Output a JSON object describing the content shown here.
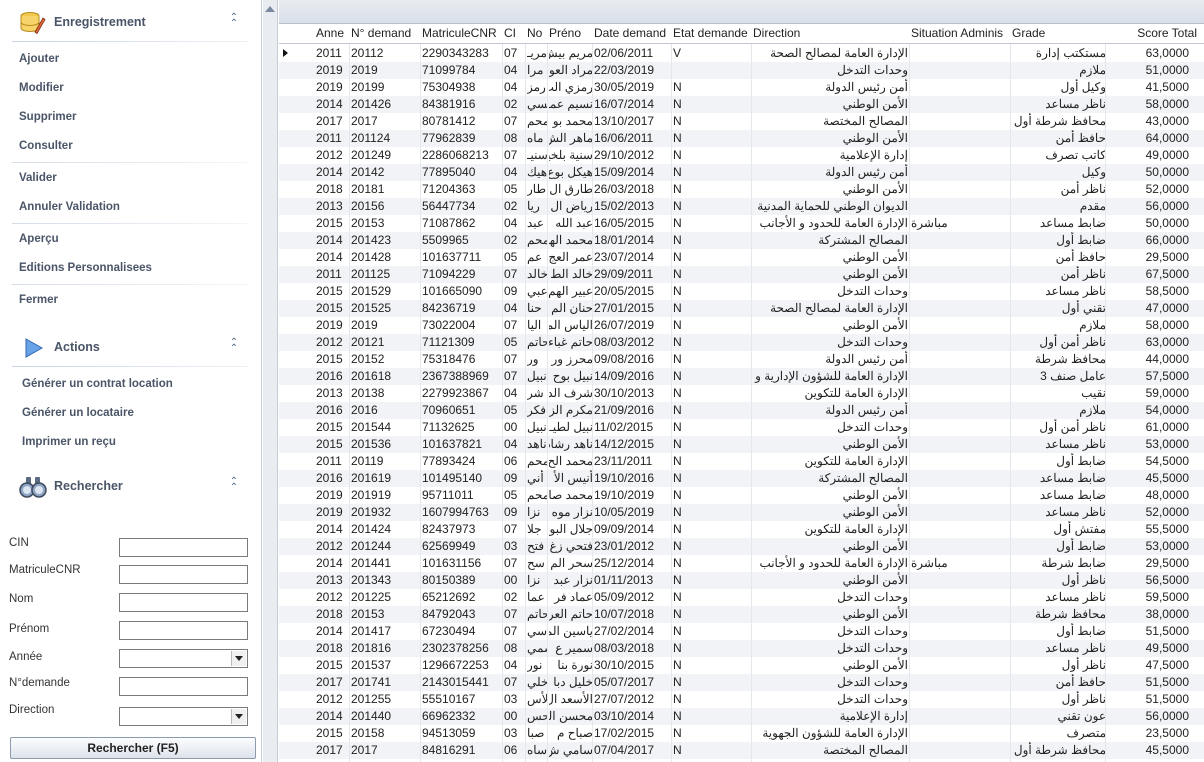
{
  "sidebar": {
    "enregistrement": {
      "title": "Enregistrement",
      "items": [
        "Ajouter",
        "Modifier",
        "Supprimer",
        "Consulter",
        "Valider",
        "Annuler Validation",
        "Aperçu",
        "Editions Personnalisees",
        "Fermer"
      ]
    },
    "actions": {
      "title": "Actions",
      "items": [
        "Générer un contrat location",
        "Générer un locataire",
        "Imprimer un reçu"
      ]
    },
    "rechercher": {
      "title": "Rechercher",
      "fields": [
        {
          "label": "CIN",
          "type": "text",
          "value": ""
        },
        {
          "label": "MatriculeCNR",
          "type": "text",
          "value": ""
        },
        {
          "label": "Nom",
          "type": "text",
          "value": ""
        },
        {
          "label": "Prénom",
          "type": "text",
          "value": ""
        },
        {
          "label": "Année",
          "type": "select",
          "value": ""
        },
        {
          "label": "N°demande",
          "type": "text",
          "value": ""
        },
        {
          "label": "Direction",
          "type": "select",
          "value": ""
        }
      ],
      "button_label": "Rechercher (F5)"
    }
  },
  "grid": {
    "columns": [
      "Anne",
      "N° demand",
      "MatriculeCNR",
      "CI",
      "No",
      "Préno",
      "Date demand",
      "Etat demande",
      "Direction",
      "Situation Adminis",
      "Grade",
      "Score Total"
    ],
    "rows": [
      [
        "2011",
        "20112",
        "2290343283",
        "07",
        "مريـ",
        "مريم بيش",
        "02/06/2011",
        "V",
        "الإدارة العامة لمصالح الصحة",
        "",
        "مستكتب إدارة",
        "63,0000"
      ],
      [
        "2019",
        "2019",
        "71099784",
        "04",
        "مرا",
        "مراد العو",
        "22/03/2019",
        "",
        "وحدات التدخل",
        "",
        "ملازم",
        "51,0000"
      ],
      [
        "2019",
        "20199",
        "75304938",
        "04",
        "رمز",
        "رمزي الب",
        "30/05/2019",
        "N",
        "أمن رئيس الدولة",
        "",
        "وكيل أول",
        "41,5000"
      ],
      [
        "2014",
        "201426",
        "84381916",
        "02",
        "نسي",
        "نسيم عما",
        "16/07/2014",
        "N",
        "الأمن الوطني",
        "",
        "ناظر مساعد",
        "58,0000"
      ],
      [
        "2017",
        "2017",
        "80781412",
        "07",
        "محم",
        "محمد بو",
        "13/10/2017",
        "N",
        "المصالح المختصة",
        "",
        "محافظ شرطة أول",
        "43,0000"
      ],
      [
        "2011",
        "201124",
        "77962839",
        "08",
        "ماه",
        "ماهر الش",
        "16/06/2011",
        "N",
        "الأمن الوطني",
        "",
        "حافظ أمن",
        "64,0000"
      ],
      [
        "2012",
        "201249",
        "2286068213",
        "07",
        "سنيـ",
        "سنية بلخير",
        "29/10/2012",
        "N",
        "إدارة الإعلامية",
        "",
        "كاتب تصرف",
        "49,0000"
      ],
      [
        "2014",
        "20142",
        "77895040",
        "04",
        "هيك",
        "هيكل بوع",
        "15/09/2014",
        "N",
        "أمن رئيس الدولة",
        "",
        "وكيل",
        "50,0000"
      ],
      [
        "2018",
        "20181",
        "71204363",
        "05",
        "طار",
        "طارق ال",
        "26/03/2018",
        "N",
        "الأمن الوطني",
        "",
        "ناظر أمن",
        "52,0000"
      ],
      [
        "2013",
        "20156",
        "56447734",
        "02",
        "ريا",
        "رياض ال",
        "15/02/2013",
        "N",
        "الديوان الوطني للحماية المدنية",
        "",
        "مقدم",
        "56,0000"
      ],
      [
        "2015",
        "20153",
        "71087862",
        "04",
        "عبد",
        "عبد الله",
        "16/05/2015",
        "N",
        "الإدارة العامة للحدود و الأجانب",
        "مباشرة",
        "ضابط مساعد",
        "50,0000"
      ],
      [
        "2014",
        "201423",
        "5509965",
        "02",
        "محم",
        "محمد الها",
        "18/01/2014",
        "N",
        "المصالح المشتركة",
        "",
        "ضابط أول",
        "66,0000"
      ],
      [
        "2014",
        "201428",
        "101637711",
        "05",
        "عم",
        "عمر العج",
        "23/07/2014",
        "N",
        "الأمن الوطني",
        "",
        "حافظ أمن",
        "29,5000"
      ],
      [
        "2011",
        "201125",
        "71094229",
        "07",
        "خالد",
        "خالد الط",
        "29/09/2011",
        "N",
        "الأمن الوطني",
        "",
        "ناظر أمن",
        "67,5000"
      ],
      [
        "2015",
        "201529",
        "101665090",
        "09",
        "عبي",
        "عبير الهم",
        "20/05/2015",
        "N",
        "وحدات التدخل",
        "",
        "ناظر مساعد",
        "58,5000"
      ],
      [
        "2015",
        "201525",
        "84236719",
        "04",
        "حنا",
        "حنان الم",
        "27/01/2015",
        "N",
        "الإدارة العامة لمصالح الصحة",
        "",
        "تقني أول",
        "47,0000"
      ],
      [
        "2019",
        "2019",
        "73022004",
        "07",
        "اليا",
        "الياس الم",
        "26/07/2019",
        "N",
        "الأمن الوطني",
        "",
        "ملازم",
        "58,0000"
      ],
      [
        "2012",
        "20121",
        "71121309",
        "05",
        "حاتم",
        "حاتم غباء",
        "08/03/2012",
        "N",
        "وحدات التدخل",
        "",
        "ناظر أمن أول",
        "63,0000"
      ],
      [
        "2015",
        "20152",
        "75318476",
        "07",
        "ور",
        "محرز ور",
        "09/08/2016",
        "N",
        "أمن رئيس الدولة",
        "",
        "محافظ شرطة",
        "44,0000"
      ],
      [
        "2016",
        "201618",
        "2367388969",
        "07",
        "نبيل",
        "نبيل بوح",
        "14/09/2016",
        "N",
        "الإدارة العامة للشؤون الإدارية و المالية",
        "",
        "عامل صنف 3",
        "57,5000"
      ],
      [
        "2013",
        "20138",
        "2279923867",
        "04",
        "شر",
        "شرف الد",
        "30/10/2013",
        "N",
        "الإدارة العامة للتكوين",
        "",
        "نقيب",
        "59,0000"
      ],
      [
        "2016",
        "2016",
        "70960651",
        "05",
        "فكر",
        "مكرم الز",
        "21/09/2016",
        "N",
        "أمن رئيس الدولة",
        "",
        "ملازم",
        "54,0000"
      ],
      [
        "2015",
        "201544",
        "71132625",
        "00",
        "نبيل",
        "نبيل لطيـ",
        "11/02/2015",
        "N",
        "وحدات التدخل",
        "",
        "ناظر أمن أول",
        "61,0000"
      ],
      [
        "2015",
        "201536",
        "101637821",
        "04",
        "ناهد",
        "ناهد رشاد",
        "14/12/2015",
        "N",
        "الأمن الوطني",
        "",
        "ناظر مساعد",
        "53,0000"
      ],
      [
        "2011",
        "20119",
        "77893424",
        "06",
        "محم",
        "محمد الح",
        "23/11/2011",
        "N",
        "الإدارة العامة للتكوين",
        "",
        "ضابط أول",
        "54,5000"
      ],
      [
        "2016",
        "201619",
        "101495140",
        "09",
        "أني",
        "أنيس الأ",
        "19/10/2016",
        "N",
        "المصالح المشتركة",
        "",
        "ضابط مساعد",
        "45,5000"
      ],
      [
        "2019",
        "201919",
        "95711011",
        "05",
        "محم",
        "محمد صا",
        "19/10/2019",
        "N",
        "الأمن الوطني",
        "",
        "ضابط مساعد",
        "48,0000"
      ],
      [
        "2019",
        "201932",
        "1607994763",
        "09",
        "نزا",
        "نزار موه",
        "10/05/2019",
        "N",
        "الأمن الوطني",
        "",
        "ناظر مساعد",
        "52,0000"
      ],
      [
        "2014",
        "201424",
        "82437973",
        "07",
        "جلا",
        "جلال البو",
        "09/09/2014",
        "N",
        "الإدارة العامة للتكوين",
        "",
        "مفتش أول",
        "55,5000"
      ],
      [
        "2012",
        "201244",
        "62569949",
        "03",
        "فتح",
        "فتحي زغ",
        "23/01/2012",
        "N",
        "الأمن الوطني",
        "",
        "ضابط أول",
        "53,0000"
      ],
      [
        "2014",
        "201441",
        "101631156",
        "07",
        "سح",
        "سحر الم",
        "25/12/2014",
        "N",
        "الإدارة العامة للحدود و الأجانب",
        "مباشرة",
        "ضابط شرطة",
        "29,5000"
      ],
      [
        "2013",
        "201343",
        "80150389",
        "00",
        "نزا",
        "نزار عبد",
        "01/11/2013",
        "N",
        "الأمن الوطني",
        "",
        "ناظر أول",
        "56,5000"
      ],
      [
        "2012",
        "201225",
        "65212692",
        "02",
        "عما",
        "عماد فر",
        "05/09/2012",
        "N",
        "وحدات التدخل",
        "",
        "ناظر مساعد",
        "59,5000"
      ],
      [
        "2018",
        "20153",
        "84792043",
        "07",
        "حاتم",
        "حاتم العر",
        "10/07/2018",
        "N",
        "الأمن الوطني",
        "",
        "محافظ شرطة",
        "38,0000"
      ],
      [
        "2014",
        "201417",
        "67230494",
        "07",
        "ياسي",
        "ياسين الم",
        "27/02/2014",
        "N",
        "وحدات التدخل",
        "",
        "ضابط أول",
        "51,5000"
      ],
      [
        "2018",
        "201816",
        "2302378256",
        "08",
        "سمي",
        "سمير ع",
        "08/03/2018",
        "N",
        "وحدات التدخل",
        "",
        "ناظر مساعد",
        "49,5000"
      ],
      [
        "2015",
        "201537",
        "1296672253",
        "04",
        "نور",
        "نورة بنا",
        "30/10/2015",
        "N",
        "الأمن الوطني",
        "",
        "ناظر أول",
        "47,5000"
      ],
      [
        "2017",
        "201741",
        "2143015441",
        "07",
        "خلي",
        "خليل دبا",
        "05/07/2017",
        "N",
        "وحدات التدخل",
        "",
        "حافظ أمن",
        "51,5000"
      ],
      [
        "2012",
        "201255",
        "55510167",
        "03",
        "الأس",
        "الأسعد ال",
        "27/07/2012",
        "N",
        "وحدات التدخل",
        "",
        "ناظر أول",
        "51,5000"
      ],
      [
        "2014",
        "201440",
        "66962332",
        "00",
        "محس",
        "محسن الة",
        "03/10/2014",
        "N",
        "إدارة الإعلامية",
        "",
        "عون تقني",
        "56,0000"
      ],
      [
        "2015",
        "20158",
        "94513059",
        "03",
        "صبا",
        "صباح م",
        "17/02/2015",
        "N",
        "الإدارة العامة للشؤون الجهوية",
        "",
        "متصرف",
        "23,5000"
      ],
      [
        "2017",
        "2017",
        "84816291",
        "06",
        "ساه",
        "سامي ش",
        "07/04/2017",
        "N",
        "المصالح المختصة",
        "",
        "محافظ شرطة أول",
        "45,5000"
      ]
    ]
  }
}
